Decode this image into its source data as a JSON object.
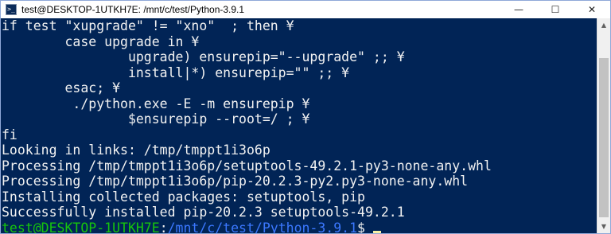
{
  "window": {
    "title": "test@DESKTOP-1UTKH7E: /mnt/c/test/Python-3.9.1",
    "controls": {
      "minimize": "—",
      "maximize": "☐",
      "close": "✕"
    }
  },
  "terminal": {
    "lines": [
      "if test \"xupgrade\" != \"xno\"  ; then ¥",
      "        case upgrade in ¥",
      "                upgrade) ensurepip=\"--upgrade\" ;; ¥",
      "                install|*) ensurepip=\"\" ;; ¥",
      "        esac; ¥",
      "         ./python.exe -E -m ensurepip ¥",
      "                $ensurepip --root=/ ; ¥",
      "fi",
      "Looking in links: /tmp/tmppt1i3o6p",
      "Processing /tmp/tmppt1i3o6p/setuptools-49.2.1-py3-none-any.whl",
      "Processing /tmp/tmppt1i3o6p/pip-20.2.3-py2.py3-none-any.whl",
      "Installing collected packages: setuptools, pip",
      "Successfully installed pip-20.2.3 setuptools-49.2.1"
    ],
    "prompt": {
      "user_host": "test@DESKTOP-1UTKH7E",
      "separator": ":",
      "path": "/mnt/c/test/Python-3.9.1",
      "symbol": "$ "
    }
  },
  "colors": {
    "background": "#012456",
    "text": "#f2f2f2",
    "prompt_user": "#16c60c",
    "prompt_path": "#3b78ff",
    "cursor": "#f9f1a5"
  }
}
